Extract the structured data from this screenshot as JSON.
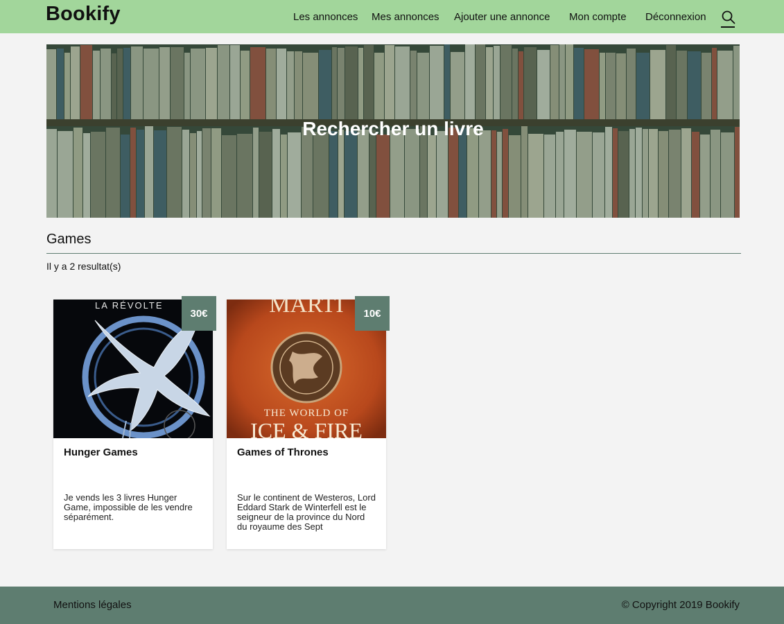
{
  "header": {
    "logo": "Bookify",
    "nav": [
      {
        "label": "Les annonces"
      },
      {
        "label": "Mes annonces"
      },
      {
        "label": "Ajouter une annonce"
      },
      {
        "label": "Mon compte"
      },
      {
        "label": "Déconnexion"
      }
    ],
    "search_icon": "search-icon"
  },
  "hero": {
    "title": "Rechercher un livre"
  },
  "search": {
    "value": "Games"
  },
  "results": {
    "count_text": "Il y a 2 resultat(s)"
  },
  "cards": [
    {
      "price": "30€",
      "title": "Hunger Games",
      "description": "Je vends les 3 livres Hunger Game, impossible de les vendre séparément.",
      "cover_text": "LA RÉVOLTE"
    },
    {
      "price": "10€",
      "title": "Games of Thrones",
      "description": "Sur le continent de Westeros, Lord Eddard Stark de Winterfell est le seigneur de la province du Nord du royaume des Sept",
      "cover_text_top": "MARTI",
      "cover_text_bottom": "THE WORLD OF ICE & FIRE"
    }
  ],
  "footer": {
    "legal": "Mentions légales",
    "copyright": "© Copyright 2019 Bookify"
  },
  "colors": {
    "header_bg": "#a2d69b",
    "accent": "#5e7d70",
    "page_bg": "#f3f3f3"
  }
}
